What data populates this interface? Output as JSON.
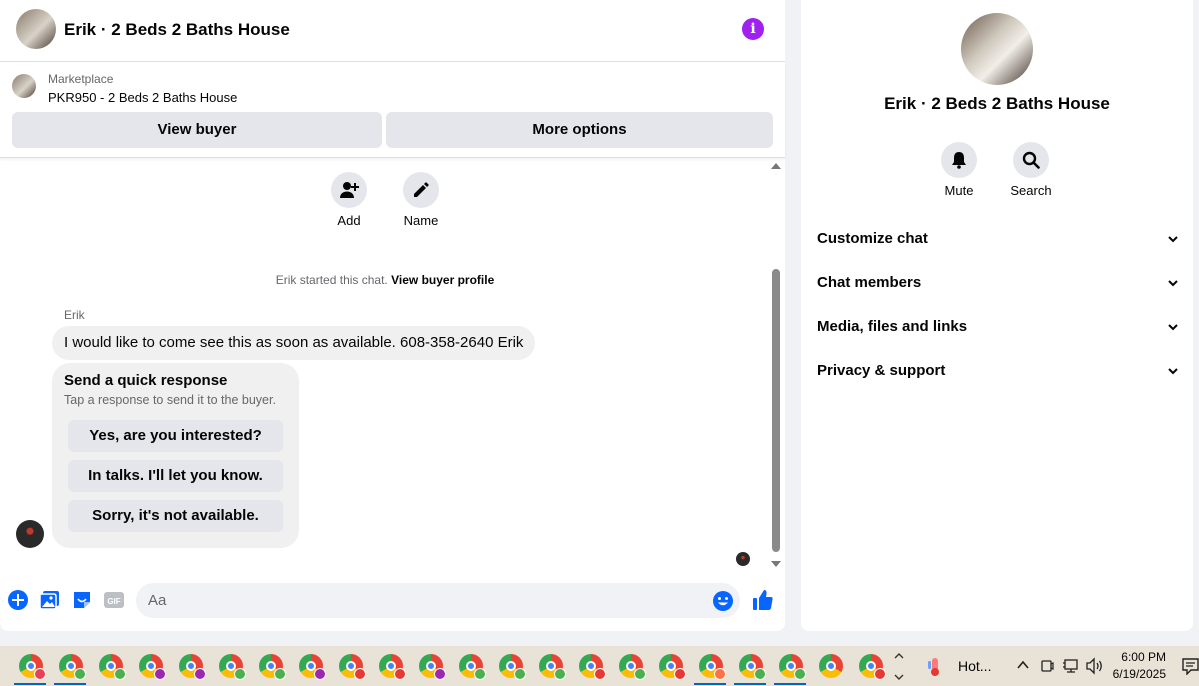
{
  "header": {
    "title": "Erik · 2 Beds 2 Baths House"
  },
  "marketplace": {
    "label": "Marketplace",
    "listing": "PKR950 - 2 Beds 2 Baths House",
    "view_buyer": "View buyer",
    "more_options": "More options"
  },
  "actions": {
    "add": "Add",
    "name": "Name"
  },
  "thread": {
    "started_text": "Erik started this chat.",
    "view_profile": "View buyer profile",
    "sender": "Erik",
    "message": "I would like to come see this as soon as available. 608-358-2640 Erik",
    "quick": {
      "title": "Send a quick response",
      "subtitle": "Tap a response to send it to the buyer.",
      "options": [
        "Yes, are you interested?",
        "In talks. I'll let you know.",
        "Sorry, it's not available."
      ]
    }
  },
  "composer": {
    "placeholder": "Aa"
  },
  "side": {
    "title": "Erik · 2 Beds 2 Baths House",
    "mute": "Mute",
    "search": "Search",
    "sections": [
      "Customize chat",
      "Chat members",
      "Media, files and links",
      "Privacy & support"
    ]
  },
  "taskbar": {
    "weather": "Hot...",
    "time": "6:00 PM",
    "date": "6/19/2025",
    "badge_colors": [
      "#e8405a",
      "#4caf50",
      "#4caf50",
      "#9c27b0",
      "#9c27b0",
      "#4caf50",
      "#4caf50",
      "#9c27b0",
      "#e53935",
      "#e53935",
      "#9c27b0",
      "#4caf50",
      "#4caf50",
      "#4caf50",
      "#e53935",
      "#4caf50",
      "#e53935",
      "#ff7043",
      "#4caf50",
      "#4caf50",
      "#ffffff",
      "#e53935"
    ],
    "active_apps": [
      0,
      1,
      17,
      18,
      19
    ]
  },
  "colors": {
    "accent": "#0866ff",
    "info": "#a020f0"
  }
}
